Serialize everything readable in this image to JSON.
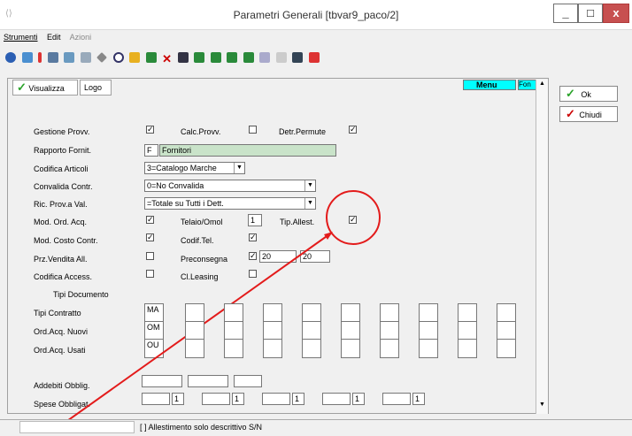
{
  "window": {
    "title": "Parametri Generali [tbvar9_paco/2]",
    "min": "_",
    "max": "□",
    "close": "x"
  },
  "menubar": [
    "Strumenti",
    "Edit",
    "Azioni"
  ],
  "tabs": {
    "visualizza": "Visualizza",
    "logo": "Logo",
    "menu": "Menu",
    "fon": "Fon"
  },
  "buttons": {
    "ok": "Ok",
    "chiudi": "Chiudi"
  },
  "form": {
    "gestione_provv": "Gestione Provv.",
    "calc_provv": "Calc.Provv.",
    "detr_permute": "Detr.Permute",
    "rapporto_fornit": "Rapporto Fornit.",
    "rapporto_code": "F",
    "rapporto_desc": "Fornitori",
    "codifica_articoli": "Codifica Articoli",
    "codifica_articoli_val": "3=Catalogo Marche",
    "convalida_contr": "Convalida Contr.",
    "convalida_contr_val": "0=No Convalida",
    "ric_prov": "Ric. Prov.a Val.",
    "ric_prov_val": "=Totale su Tutti i Dett.",
    "mod_ord_acq": "Mod. Ord. Acq.",
    "telaio_omol": "Telaio/Omol",
    "telaio_val": "1",
    "tip_allest": "Tip.Allest.",
    "mod_costo_contr": "Mod. Costo Contr.",
    "codif_tel": "Codif.Tel.",
    "prz_vendita": "Prz.Vendita All.",
    "preconsegna": "Preconsegna",
    "preconsegna_v1": "20",
    "preconsegna_v2": "20",
    "codifica_access": "Codifica Access.",
    "cl_leasing": "Cl.Leasing",
    "tipi_documento": "Tipi Documento",
    "tipi_contratto": "Tipi Contratto",
    "tipi_contratto_first": "MA",
    "ord_acq_nuovi": "Ord.Acq. Nuovi",
    "ord_acq_nuovi_first": "OM",
    "ord_acq_usati": "Ord.Acq. Usati",
    "ord_acq_usati_first": "OU",
    "addebiti_obblig": "Addebiti Obblig.",
    "spese_obbligat": "Spese Obbligat.",
    "spese_one": "1"
  },
  "status": "[ ] Allestimento solo descrittivo S/N"
}
